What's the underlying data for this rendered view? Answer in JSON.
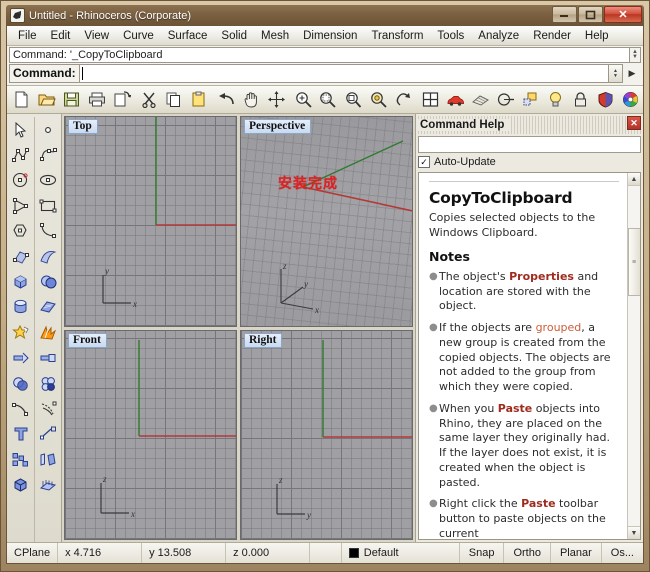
{
  "window": {
    "title": "Untitled - Rhinoceros (Corporate)",
    "logo_icon": "rhino-logo-icon",
    "minimize_label": "–",
    "maximize_label": "❐",
    "close_label": "✕"
  },
  "menubar": {
    "items": [
      {
        "label": "File"
      },
      {
        "label": "Edit"
      },
      {
        "label": "View"
      },
      {
        "label": "Curve"
      },
      {
        "label": "Surface"
      },
      {
        "label": "Solid"
      },
      {
        "label": "Mesh"
      },
      {
        "label": "Dimension"
      },
      {
        "label": "Transform"
      },
      {
        "label": "Tools"
      },
      {
        "label": "Analyze"
      },
      {
        "label": "Render"
      },
      {
        "label": "Help"
      }
    ]
  },
  "command_area": {
    "history_line": "Command: '_CopyToClipboard",
    "prompt_label": "Command:",
    "input_value": "",
    "input_placeholder": ""
  },
  "toolbar": {
    "items": [
      {
        "name": "new-file-icon",
        "tooltip": "New"
      },
      {
        "name": "open-file-icon",
        "tooltip": "Open"
      },
      {
        "name": "save-file-icon",
        "tooltip": "Save"
      },
      {
        "name": "print-icon",
        "tooltip": "Print"
      },
      {
        "name": "copy-to-clipboard-icon",
        "tooltip": "Copy to clipboard"
      },
      {
        "name": "cut-icon",
        "tooltip": "Cut"
      },
      {
        "name": "copy-icon",
        "tooltip": "Copy"
      },
      {
        "name": "paste-icon",
        "tooltip": "Paste"
      },
      {
        "name": "undo-icon",
        "tooltip": "Undo"
      },
      {
        "name": "pan-hand-icon",
        "tooltip": "Pan"
      },
      {
        "name": "gumball-move-icon",
        "tooltip": "Move"
      },
      {
        "name": "zoom-in-icon",
        "tooltip": "Zoom in"
      },
      {
        "name": "zoom-window-icon",
        "tooltip": "Zoom window"
      },
      {
        "name": "zoom-selected-icon",
        "tooltip": "Zoom selected"
      },
      {
        "name": "zoom-extents-icon",
        "tooltip": "Zoom extents"
      },
      {
        "name": "zoom-previous-icon",
        "tooltip": "Zoom previous"
      },
      {
        "name": "viewport-layout-icon",
        "tooltip": "Viewport layout"
      },
      {
        "name": "render-car-icon",
        "tooltip": "Render"
      },
      {
        "name": "render-mesh-icon",
        "tooltip": "Render mesh"
      },
      {
        "name": "layer-icon",
        "tooltip": "Layers"
      },
      {
        "name": "properties-icon",
        "tooltip": "Properties"
      },
      {
        "name": "light-bulb-icon",
        "tooltip": "Lights"
      },
      {
        "name": "lock-icon",
        "tooltip": "Lock"
      },
      {
        "name": "material-shield-icon",
        "tooltip": "Material"
      },
      {
        "name": "color-wheel-icon",
        "tooltip": "Color"
      }
    ]
  },
  "sidebar": {
    "column_left": [
      {
        "name": "select-arrow-icon"
      },
      {
        "name": "polyline-icon"
      },
      {
        "name": "circle-icon"
      },
      {
        "name": "arc-icon"
      },
      {
        "name": "polygon-icon"
      },
      {
        "name": "surface-from-curves-icon"
      },
      {
        "name": "box-icon"
      },
      {
        "name": "cylinder-icon"
      },
      {
        "name": "boolean-union-star-icon"
      },
      {
        "name": "trim-icon"
      },
      {
        "name": "boolean-sphere-icon"
      },
      {
        "name": "fillet-curve-icon"
      },
      {
        "name": "text-object-icon"
      },
      {
        "name": "array-icon"
      },
      {
        "name": "solid-box-edit-icon"
      }
    ],
    "column_right": [
      {
        "name": "point-icon"
      },
      {
        "name": "control-point-curve-icon"
      },
      {
        "name": "ellipse-icon"
      },
      {
        "name": "rectangle-icon"
      },
      {
        "name": "interpolate-curve-icon"
      },
      {
        "name": "surface-sweep-icon"
      },
      {
        "name": "sphere-icon"
      },
      {
        "name": "planar-surface-icon"
      },
      {
        "name": "explode-icon"
      },
      {
        "name": "split-icon"
      },
      {
        "name": "boolean-difference-icon"
      },
      {
        "name": "offset-curve-icon"
      },
      {
        "name": "dimension-icon"
      },
      {
        "name": "copy-object-icon"
      },
      {
        "name": "mesh-from-surface-icon"
      }
    ]
  },
  "viewports": [
    {
      "id": "top",
      "label": "Top",
      "axis_labels": [
        "y",
        "x"
      ],
      "overlay_text": ""
    },
    {
      "id": "perspective",
      "label": "Perspective",
      "axis_labels": [
        "z",
        "y",
        "x"
      ],
      "overlay_text": "安装完成",
      "overlay_color": "#e02020"
    },
    {
      "id": "front",
      "label": "Front",
      "axis_labels": [
        "z",
        "x"
      ],
      "overlay_text": ""
    },
    {
      "id": "right",
      "label": "Right",
      "axis_labels": [
        "z",
        "y"
      ],
      "overlay_text": ""
    }
  ],
  "help_panel": {
    "title": "Command Help",
    "close_label": "✕",
    "search_value": "",
    "search_placeholder": "",
    "auto_update_label": "Auto-Update",
    "auto_update_checked": true,
    "checkmark": "✓",
    "heading": "CopyToClipboard",
    "summary": "Copies selected objects to the Windows Clipboard.",
    "notes_heading": "Notes",
    "notes": [
      {
        "parts": [
          {
            "text": "The object's ",
            "style": "normal"
          },
          {
            "text": "Properties",
            "style": "keyword"
          },
          {
            "text": " and location are stored with the object.",
            "style": "normal"
          }
        ]
      },
      {
        "parts": [
          {
            "text": "If the objects are ",
            "style": "normal"
          },
          {
            "text": "grouped",
            "style": "link"
          },
          {
            "text": ", a new group is created from the copied objects. The objects are not added to the group from which they were copied.",
            "style": "normal"
          }
        ]
      },
      {
        "parts": [
          {
            "text": "When you ",
            "style": "normal"
          },
          {
            "text": "Paste",
            "style": "keyword"
          },
          {
            "text": " objects into Rhino, they are placed on the same layer they originally had. If the layer does not exist, it is created when the object is pasted.",
            "style": "normal"
          }
        ]
      },
      {
        "parts": [
          {
            "text": "Right click the ",
            "style": "normal"
          },
          {
            "text": "Paste",
            "style": "keyword"
          },
          {
            "text": " toolbar button to paste objects on the current",
            "style": "normal"
          }
        ]
      }
    ],
    "scroll_up": "▲",
    "scroll_down": "▼"
  },
  "statusbar": {
    "cplane_label": "CPlane",
    "x_value": "x 4.716",
    "y_value": "y 13.508",
    "z_value": "z 0.000",
    "layer_name": "Default",
    "layer_color": "#000000",
    "toggles": [
      {
        "label": "Snap"
      },
      {
        "label": "Ortho"
      },
      {
        "label": "Planar"
      },
      {
        "label": "Os..."
      }
    ]
  }
}
